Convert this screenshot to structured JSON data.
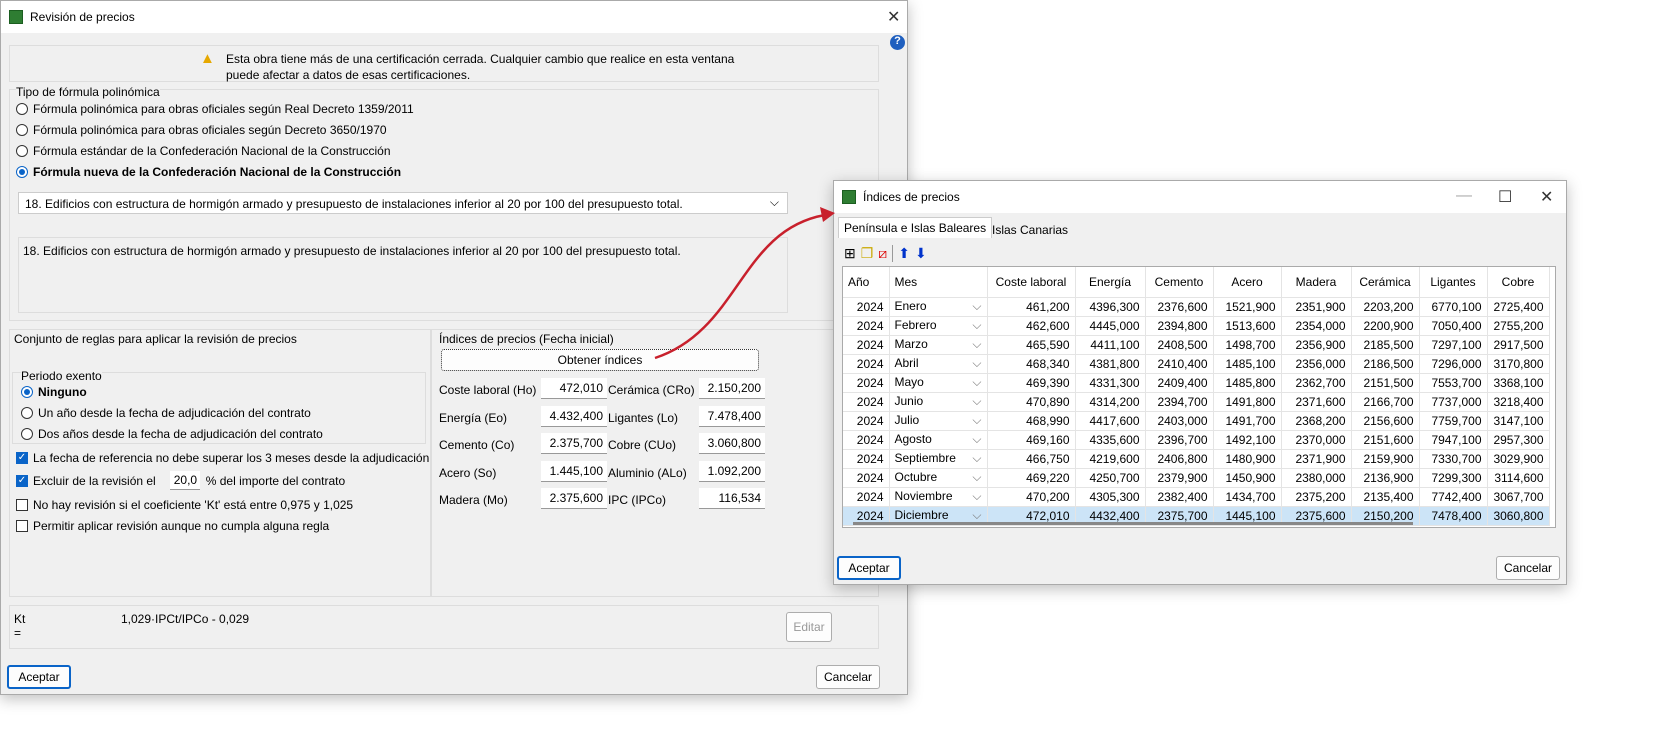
{
  "main": {
    "title": "Revisión de precios",
    "warning": "Esta obra tiene más de una certificación cerrada. Cualquier cambio que realice en esta ventana puede afectar a datos de esas certificaciones.",
    "formula_group": "Tipo de fórmula polinómica",
    "formula_options": [
      {
        "label": "Fórmula polinómica para obras oficiales según Real Decreto 1359/2011",
        "selected": false
      },
      {
        "label": "Fórmula polinómica para obras oficiales según Decreto 3650/1970",
        "selected": false
      },
      {
        "label": "Fórmula estándar de la Confederación Nacional de la Construcción",
        "selected": false
      },
      {
        "label": "Fórmula nueva de la Confederación Nacional de la Construcción",
        "selected": true
      }
    ],
    "formula_select": "18. Edificios con estructura de hormigón armado y presupuesto de instalaciones inferior al 20 por 100 del presupuesto total.",
    "formula_desc": "18. Edificios con estructura de hormigón armado y presupuesto de instalaciones inferior al 20 por 100 del presupuesto total.",
    "rules_group": "Conjunto de reglas para aplicar la revisión de precios",
    "periodo_group": "Periodo exento",
    "periodo_options": [
      {
        "label": "Ninguno",
        "selected": true
      },
      {
        "label": "Un año desde la fecha de adjudicación del contrato",
        "selected": false
      },
      {
        "label": "Dos años desde la fecha de adjudicación del contrato",
        "selected": false
      }
    ],
    "check_fecha": "La fecha de referencia no debe superar los 3 meses desde la adjudicación",
    "check_excluir_a": "Excluir de la revisión el",
    "excluir_value": "20,0",
    "check_excluir_b": "%  del importe del contrato",
    "check_kt": "No hay revisión si el coeficiente 'Kt' está entre 0,975 y 1,025",
    "check_permitir": "Permitir aplicar revisión aunque no cumpla alguna regla",
    "indices_group": "Índices de precios (Fecha inicial)",
    "obtener": "Obtener índices",
    "indices": [
      {
        "label": "Coste laboral (Ho)",
        "value": "472,010"
      },
      {
        "label": "Energía (Eo)",
        "value": "4.432,400"
      },
      {
        "label": "Cemento (Co)",
        "value": "2.375,700"
      },
      {
        "label": "Acero (So)",
        "value": "1.445,100"
      },
      {
        "label": "Madera (Mo)",
        "value": "2.375,600"
      },
      {
        "label": "Cerámica (CRo)",
        "value": "2.150,200"
      },
      {
        "label": "Ligantes (Lo)",
        "value": "7.478,400"
      },
      {
        "label": "Cobre (CUo)",
        "value": "3.060,800"
      },
      {
        "label": "Aluminio (ALo)",
        "value": "1.092,200"
      },
      {
        "label": "IPC (IPCo)",
        "value": "116,534"
      }
    ],
    "kt_label": "Kt =",
    "kt_formula": "1,029·IPCt/IPCo - 0,029",
    "editar": "Editar",
    "aceptar": "Aceptar",
    "cancelar": "Cancelar"
  },
  "dialog": {
    "title": "Índices de precios",
    "tabs": [
      "Península e Islas Baleares",
      "Islas Canarias"
    ],
    "columns": [
      "Año",
      "Mes",
      "Coste laboral",
      "Energía",
      "Cemento",
      "Acero",
      "Madera",
      "Cerámica",
      "Ligantes",
      "Cobre"
    ],
    "rows": [
      [
        "2024",
        "Enero",
        "461,200",
        "4396,300",
        "2376,600",
        "1521,900",
        "2351,900",
        "2203,200",
        "6770,100",
        "2725,400"
      ],
      [
        "2024",
        "Febrero",
        "462,600",
        "4445,000",
        "2394,800",
        "1513,600",
        "2354,000",
        "2200,900",
        "7050,400",
        "2755,200"
      ],
      [
        "2024",
        "Marzo",
        "465,590",
        "4411,100",
        "2408,500",
        "1498,700",
        "2356,900",
        "2185,500",
        "7297,100",
        "2917,500"
      ],
      [
        "2024",
        "Abril",
        "468,340",
        "4381,800",
        "2410,400",
        "1485,100",
        "2356,000",
        "2186,500",
        "7296,000",
        "3170,800"
      ],
      [
        "2024",
        "Mayo",
        "469,390",
        "4331,300",
        "2409,400",
        "1485,800",
        "2362,700",
        "2151,500",
        "7553,700",
        "3368,100"
      ],
      [
        "2024",
        "Junio",
        "470,890",
        "4314,200",
        "2394,700",
        "1491,800",
        "2371,600",
        "2166,700",
        "7737,000",
        "3218,400"
      ],
      [
        "2024",
        "Julio",
        "468,990",
        "4417,600",
        "2403,000",
        "1491,700",
        "2368,200",
        "2156,600",
        "7759,700",
        "3147,100"
      ],
      [
        "2024",
        "Agosto",
        "469,160",
        "4335,600",
        "2396,700",
        "1492,100",
        "2370,000",
        "2151,600",
        "7947,100",
        "2957,300"
      ],
      [
        "2024",
        "Septiembre",
        "466,750",
        "4219,600",
        "2406,800",
        "1480,900",
        "2371,900",
        "2159,900",
        "7330,700",
        "3029,900"
      ],
      [
        "2024",
        "Octubre",
        "469,220",
        "4250,700",
        "2379,900",
        "1450,900",
        "2380,000",
        "2136,900",
        "7299,300",
        "3114,600"
      ],
      [
        "2024",
        "Noviembre",
        "470,200",
        "4305,300",
        "2382,400",
        "1434,700",
        "2375,200",
        "2135,400",
        "7742,400",
        "3067,700"
      ],
      [
        "2024",
        "Diciembre",
        "472,010",
        "4432,400",
        "2375,700",
        "1445,100",
        "2375,600",
        "2150,200",
        "7478,400",
        "3060,800"
      ]
    ],
    "aceptar": "Aceptar",
    "cancelar": "Cancelar"
  }
}
